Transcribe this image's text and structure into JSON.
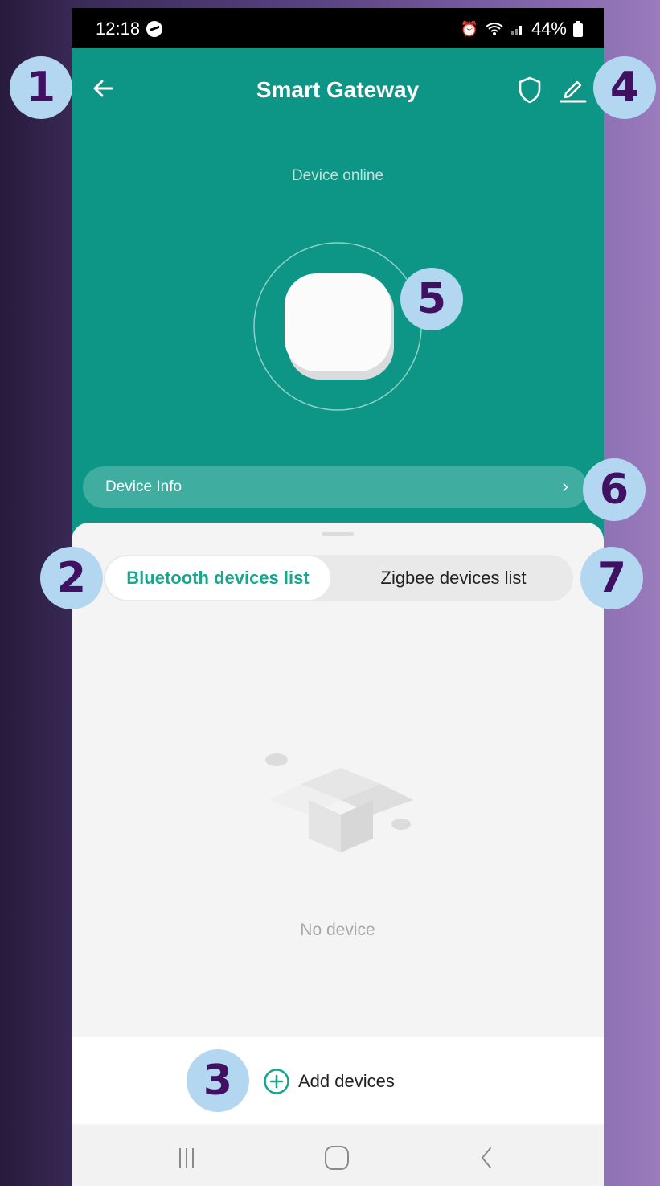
{
  "status_bar": {
    "time": "12:18",
    "battery": "44%"
  },
  "header": {
    "title": "Smart Gateway"
  },
  "device": {
    "status": "Device online",
    "info_label": "Device Info",
    "info_chevron": "›"
  },
  "tabs": [
    {
      "label": "Bluetooth devices list",
      "active": true
    },
    {
      "label": "Zigbee devices list",
      "active": false
    }
  ],
  "empty_state": {
    "text": "No device"
  },
  "actions": {
    "add_devices": "Add devices"
  },
  "badges": [
    "1",
    "2",
    "3",
    "4",
    "5",
    "6",
    "7"
  ],
  "colors": {
    "teal": "#0d9585",
    "accent": "#16a88e",
    "badge_bg": "#b3d6f1",
    "badge_text": "#3f1160"
  },
  "icons": [
    "back-arrow-icon",
    "shield-icon",
    "pencil-icon",
    "plus-circle-icon",
    "recents-icon",
    "home-icon",
    "back-icon"
  ]
}
